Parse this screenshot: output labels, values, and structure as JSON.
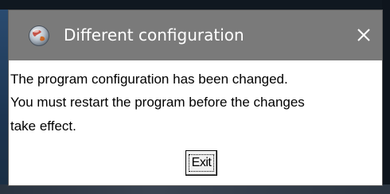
{
  "dialog": {
    "title": "Different configuration",
    "title_icon": "app-globe-icon",
    "close_icon": "close-icon",
    "message_lines": [
      "The program configuration has been changed.",
      "You must restart the program before the changes",
      "take effect."
    ],
    "exit_label": "Exit"
  },
  "colors": {
    "titlebar": "#7a7a7a",
    "title_text": "#ffffff",
    "dialog_bg": "#ffffff"
  }
}
